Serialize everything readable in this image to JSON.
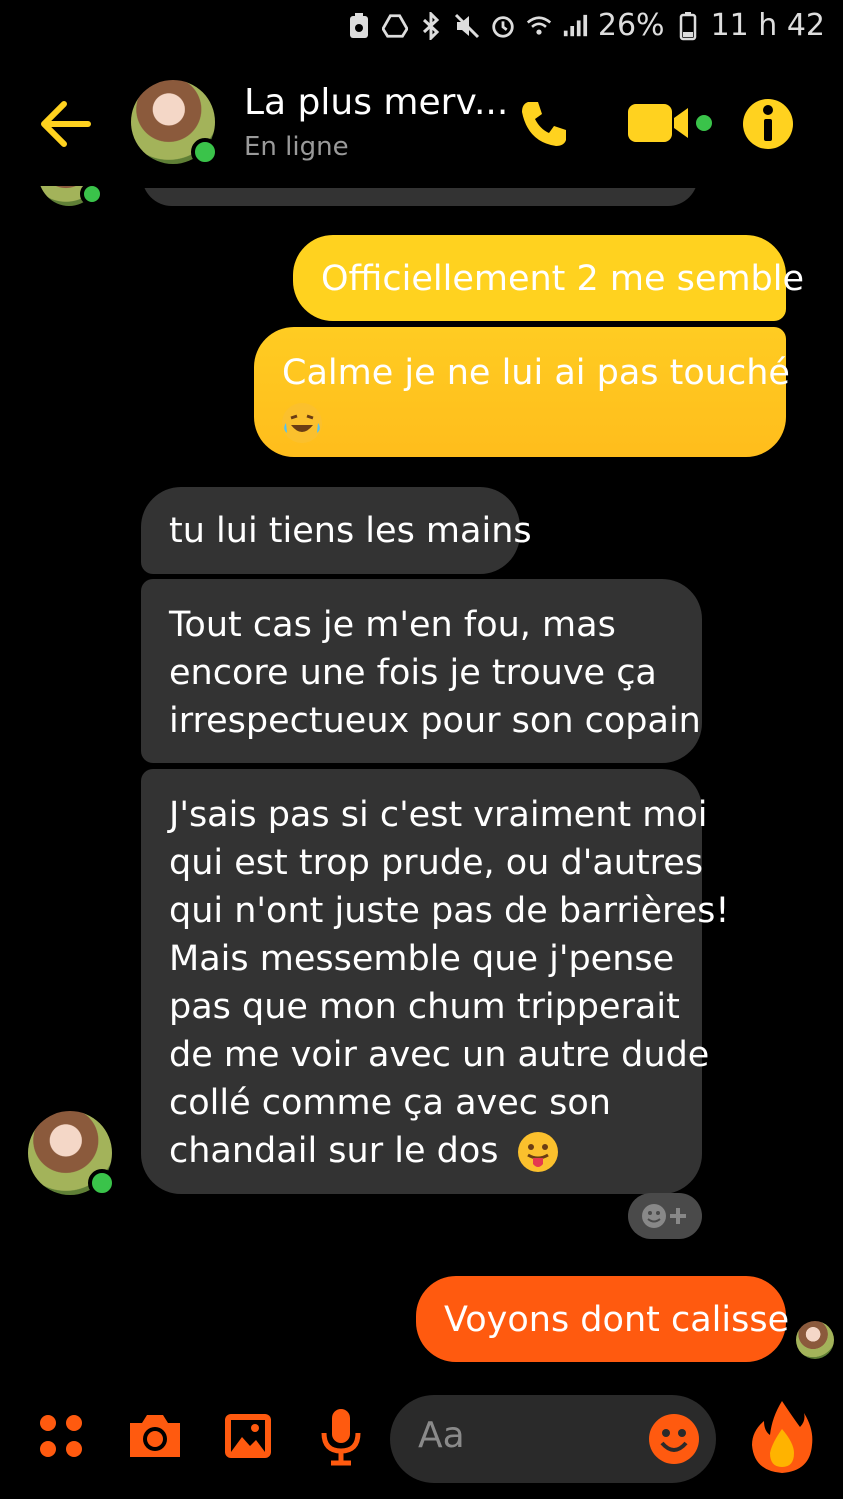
{
  "status_bar": {
    "battery": "26%",
    "time": "11 h 42"
  },
  "header": {
    "contact_name": "La plus merv...",
    "presence": "En ligne",
    "icons": [
      "back-arrow-icon",
      "phone-icon",
      "video-camera-icon",
      "info-icon"
    ],
    "accent_color": "#ffd21f"
  },
  "messages": [
    {
      "type": "sent",
      "lines": [
        "Officiellement 2 me semble"
      ],
      "color": "#ffd21f"
    },
    {
      "type": "sent",
      "lines": [
        "Calme je ne lui ai pas touché"
      ],
      "emoji": "laughing-tears-emoji",
      "color": "#ffc21f"
    },
    {
      "type": "received",
      "lines": [
        "tu lui tiens les mains"
      ]
    },
    {
      "type": "received",
      "lines": [
        "Tout cas je m'en fou, mas",
        "encore une fois je trouve ça",
        "irrespectueux pour son copain"
      ]
    },
    {
      "type": "received",
      "lines": [
        "J'sais pas si c'est vraiment moi",
        "qui est trop prude, ou d'autres",
        "qui n'ont juste pas de barrières!",
        "Mais messemble que j'pense",
        "pas que mon chum tripperait",
        "de me voir avec un autre dude",
        "collé comme ça avec son",
        "chandail sur le dos"
      ],
      "emoji": "tongue-out-emoji"
    },
    {
      "type": "sent",
      "lines": [
        "Voyons dont calisse"
      ],
      "color": "#ff5a0f"
    }
  ],
  "composer": {
    "placeholder": "Aa",
    "tools": [
      "apps-icon",
      "camera-icon",
      "image-icon",
      "microphone-icon",
      "emoji-icon",
      "fire-icon"
    ],
    "tool_color": "#ff5a0f"
  }
}
